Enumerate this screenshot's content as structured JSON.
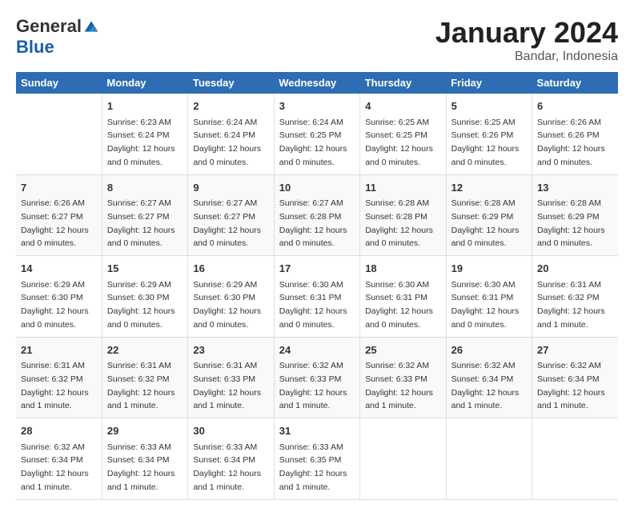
{
  "logo": {
    "general": "General",
    "blue": "Blue"
  },
  "title": "January 2024",
  "location": "Bandar, Indonesia",
  "days_of_week": [
    "Sunday",
    "Monday",
    "Tuesday",
    "Wednesday",
    "Thursday",
    "Friday",
    "Saturday"
  ],
  "weeks": [
    [
      {
        "num": "",
        "info": ""
      },
      {
        "num": "1",
        "info": "Sunrise: 6:23 AM\nSunset: 6:24 PM\nDaylight: 12 hours\nand 0 minutes."
      },
      {
        "num": "2",
        "info": "Sunrise: 6:24 AM\nSunset: 6:24 PM\nDaylight: 12 hours\nand 0 minutes."
      },
      {
        "num": "3",
        "info": "Sunrise: 6:24 AM\nSunset: 6:25 PM\nDaylight: 12 hours\nand 0 minutes."
      },
      {
        "num": "4",
        "info": "Sunrise: 6:25 AM\nSunset: 6:25 PM\nDaylight: 12 hours\nand 0 minutes."
      },
      {
        "num": "5",
        "info": "Sunrise: 6:25 AM\nSunset: 6:26 PM\nDaylight: 12 hours\nand 0 minutes."
      },
      {
        "num": "6",
        "info": "Sunrise: 6:26 AM\nSunset: 6:26 PM\nDaylight: 12 hours\nand 0 minutes."
      }
    ],
    [
      {
        "num": "7",
        "info": "Sunrise: 6:26 AM\nSunset: 6:27 PM\nDaylight: 12 hours\nand 0 minutes."
      },
      {
        "num": "8",
        "info": "Sunrise: 6:27 AM\nSunset: 6:27 PM\nDaylight: 12 hours\nand 0 minutes."
      },
      {
        "num": "9",
        "info": "Sunrise: 6:27 AM\nSunset: 6:27 PM\nDaylight: 12 hours\nand 0 minutes."
      },
      {
        "num": "10",
        "info": "Sunrise: 6:27 AM\nSunset: 6:28 PM\nDaylight: 12 hours\nand 0 minutes."
      },
      {
        "num": "11",
        "info": "Sunrise: 6:28 AM\nSunset: 6:28 PM\nDaylight: 12 hours\nand 0 minutes."
      },
      {
        "num": "12",
        "info": "Sunrise: 6:28 AM\nSunset: 6:29 PM\nDaylight: 12 hours\nand 0 minutes."
      },
      {
        "num": "13",
        "info": "Sunrise: 6:28 AM\nSunset: 6:29 PM\nDaylight: 12 hours\nand 0 minutes."
      }
    ],
    [
      {
        "num": "14",
        "info": "Sunrise: 6:29 AM\nSunset: 6:30 PM\nDaylight: 12 hours\nand 0 minutes."
      },
      {
        "num": "15",
        "info": "Sunrise: 6:29 AM\nSunset: 6:30 PM\nDaylight: 12 hours\nand 0 minutes."
      },
      {
        "num": "16",
        "info": "Sunrise: 6:29 AM\nSunset: 6:30 PM\nDaylight: 12 hours\nand 0 minutes."
      },
      {
        "num": "17",
        "info": "Sunrise: 6:30 AM\nSunset: 6:31 PM\nDaylight: 12 hours\nand 0 minutes."
      },
      {
        "num": "18",
        "info": "Sunrise: 6:30 AM\nSunset: 6:31 PM\nDaylight: 12 hours\nand 0 minutes."
      },
      {
        "num": "19",
        "info": "Sunrise: 6:30 AM\nSunset: 6:31 PM\nDaylight: 12 hours\nand 0 minutes."
      },
      {
        "num": "20",
        "info": "Sunrise: 6:31 AM\nSunset: 6:32 PM\nDaylight: 12 hours\nand 1 minute."
      }
    ],
    [
      {
        "num": "21",
        "info": "Sunrise: 6:31 AM\nSunset: 6:32 PM\nDaylight: 12 hours\nand 1 minute."
      },
      {
        "num": "22",
        "info": "Sunrise: 6:31 AM\nSunset: 6:32 PM\nDaylight: 12 hours\nand 1 minute."
      },
      {
        "num": "23",
        "info": "Sunrise: 6:31 AM\nSunset: 6:33 PM\nDaylight: 12 hours\nand 1 minute."
      },
      {
        "num": "24",
        "info": "Sunrise: 6:32 AM\nSunset: 6:33 PM\nDaylight: 12 hours\nand 1 minute."
      },
      {
        "num": "25",
        "info": "Sunrise: 6:32 AM\nSunset: 6:33 PM\nDaylight: 12 hours\nand 1 minute."
      },
      {
        "num": "26",
        "info": "Sunrise: 6:32 AM\nSunset: 6:34 PM\nDaylight: 12 hours\nand 1 minute."
      },
      {
        "num": "27",
        "info": "Sunrise: 6:32 AM\nSunset: 6:34 PM\nDaylight: 12 hours\nand 1 minute."
      }
    ],
    [
      {
        "num": "28",
        "info": "Sunrise: 6:32 AM\nSunset: 6:34 PM\nDaylight: 12 hours\nand 1 minute."
      },
      {
        "num": "29",
        "info": "Sunrise: 6:33 AM\nSunset: 6:34 PM\nDaylight: 12 hours\nand 1 minute."
      },
      {
        "num": "30",
        "info": "Sunrise: 6:33 AM\nSunset: 6:34 PM\nDaylight: 12 hours\nand 1 minute."
      },
      {
        "num": "31",
        "info": "Sunrise: 6:33 AM\nSunset: 6:35 PM\nDaylight: 12 hours\nand 1 minute."
      },
      {
        "num": "",
        "info": ""
      },
      {
        "num": "",
        "info": ""
      },
      {
        "num": "",
        "info": ""
      }
    ]
  ]
}
